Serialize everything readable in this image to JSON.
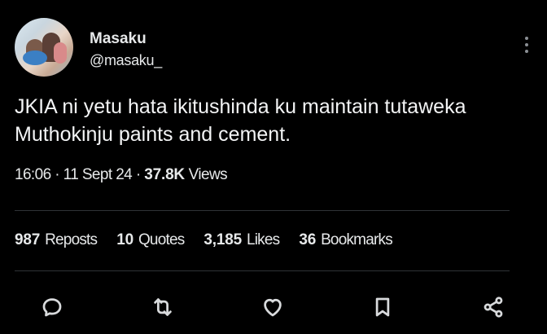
{
  "author": {
    "name": "Masaku",
    "handle": "@masaku_"
  },
  "tweet": {
    "text_line1": "JKIA ni yetu hata ikitushinda ku maintain tutaweka",
    "text_line2": "Muthokinju paints and cement."
  },
  "meta": {
    "time": "16:06",
    "date": "11 Sept 24",
    "separator": " · ",
    "views_count": "37.8K",
    "views_label": "Views"
  },
  "stats": {
    "reposts_count": "987",
    "reposts_label": "Reposts",
    "quotes_count": "10",
    "quotes_label": "Quotes",
    "likes_count": "3,185",
    "likes_label": "Likes",
    "bookmarks_count": "36",
    "bookmarks_label": "Bookmarks"
  },
  "icons": {
    "reply": "reply-icon",
    "repost": "repost-icon",
    "like": "heart-icon",
    "bookmark": "bookmark-icon",
    "share": "share-icon",
    "more": "more-vertical-icon"
  },
  "colors": {
    "background": "#000000",
    "text": "#e7e9ea",
    "divider": "#2f3336",
    "icon": "#d8dadc"
  }
}
